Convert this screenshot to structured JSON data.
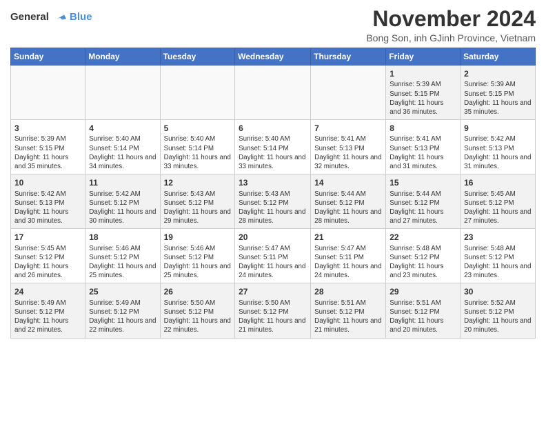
{
  "logo": {
    "line1": "General",
    "line2": "Blue"
  },
  "title": "November 2024",
  "subtitle": "Bong Son, inh GJinh Province, Vietnam",
  "weekdays": [
    "Sunday",
    "Monday",
    "Tuesday",
    "Wednesday",
    "Thursday",
    "Friday",
    "Saturday"
  ],
  "weeks": [
    [
      {
        "day": "",
        "info": ""
      },
      {
        "day": "",
        "info": ""
      },
      {
        "day": "",
        "info": ""
      },
      {
        "day": "",
        "info": ""
      },
      {
        "day": "",
        "info": ""
      },
      {
        "day": "1",
        "info": "Sunrise: 5:39 AM\nSunset: 5:15 PM\nDaylight: 11 hours and 36 minutes."
      },
      {
        "day": "2",
        "info": "Sunrise: 5:39 AM\nSunset: 5:15 PM\nDaylight: 11 hours and 35 minutes."
      }
    ],
    [
      {
        "day": "3",
        "info": "Sunrise: 5:39 AM\nSunset: 5:15 PM\nDaylight: 11 hours and 35 minutes."
      },
      {
        "day": "4",
        "info": "Sunrise: 5:40 AM\nSunset: 5:14 PM\nDaylight: 11 hours and 34 minutes."
      },
      {
        "day": "5",
        "info": "Sunrise: 5:40 AM\nSunset: 5:14 PM\nDaylight: 11 hours and 33 minutes."
      },
      {
        "day": "6",
        "info": "Sunrise: 5:40 AM\nSunset: 5:14 PM\nDaylight: 11 hours and 33 minutes."
      },
      {
        "day": "7",
        "info": "Sunrise: 5:41 AM\nSunset: 5:13 PM\nDaylight: 11 hours and 32 minutes."
      },
      {
        "day": "8",
        "info": "Sunrise: 5:41 AM\nSunset: 5:13 PM\nDaylight: 11 hours and 31 minutes."
      },
      {
        "day": "9",
        "info": "Sunrise: 5:42 AM\nSunset: 5:13 PM\nDaylight: 11 hours and 31 minutes."
      }
    ],
    [
      {
        "day": "10",
        "info": "Sunrise: 5:42 AM\nSunset: 5:13 PM\nDaylight: 11 hours and 30 minutes."
      },
      {
        "day": "11",
        "info": "Sunrise: 5:42 AM\nSunset: 5:12 PM\nDaylight: 11 hours and 30 minutes."
      },
      {
        "day": "12",
        "info": "Sunrise: 5:43 AM\nSunset: 5:12 PM\nDaylight: 11 hours and 29 minutes."
      },
      {
        "day": "13",
        "info": "Sunrise: 5:43 AM\nSunset: 5:12 PM\nDaylight: 11 hours and 28 minutes."
      },
      {
        "day": "14",
        "info": "Sunrise: 5:44 AM\nSunset: 5:12 PM\nDaylight: 11 hours and 28 minutes."
      },
      {
        "day": "15",
        "info": "Sunrise: 5:44 AM\nSunset: 5:12 PM\nDaylight: 11 hours and 27 minutes."
      },
      {
        "day": "16",
        "info": "Sunrise: 5:45 AM\nSunset: 5:12 PM\nDaylight: 11 hours and 27 minutes."
      }
    ],
    [
      {
        "day": "17",
        "info": "Sunrise: 5:45 AM\nSunset: 5:12 PM\nDaylight: 11 hours and 26 minutes."
      },
      {
        "day": "18",
        "info": "Sunrise: 5:46 AM\nSunset: 5:12 PM\nDaylight: 11 hours and 25 minutes."
      },
      {
        "day": "19",
        "info": "Sunrise: 5:46 AM\nSunset: 5:12 PM\nDaylight: 11 hours and 25 minutes."
      },
      {
        "day": "20",
        "info": "Sunrise: 5:47 AM\nSunset: 5:11 PM\nDaylight: 11 hours and 24 minutes."
      },
      {
        "day": "21",
        "info": "Sunrise: 5:47 AM\nSunset: 5:11 PM\nDaylight: 11 hours and 24 minutes."
      },
      {
        "day": "22",
        "info": "Sunrise: 5:48 AM\nSunset: 5:12 PM\nDaylight: 11 hours and 23 minutes."
      },
      {
        "day": "23",
        "info": "Sunrise: 5:48 AM\nSunset: 5:12 PM\nDaylight: 11 hours and 23 minutes."
      }
    ],
    [
      {
        "day": "24",
        "info": "Sunrise: 5:49 AM\nSunset: 5:12 PM\nDaylight: 11 hours and 22 minutes."
      },
      {
        "day": "25",
        "info": "Sunrise: 5:49 AM\nSunset: 5:12 PM\nDaylight: 11 hours and 22 minutes."
      },
      {
        "day": "26",
        "info": "Sunrise: 5:50 AM\nSunset: 5:12 PM\nDaylight: 11 hours and 22 minutes."
      },
      {
        "day": "27",
        "info": "Sunrise: 5:50 AM\nSunset: 5:12 PM\nDaylight: 11 hours and 21 minutes."
      },
      {
        "day": "28",
        "info": "Sunrise: 5:51 AM\nSunset: 5:12 PM\nDaylight: 11 hours and 21 minutes."
      },
      {
        "day": "29",
        "info": "Sunrise: 5:51 AM\nSunset: 5:12 PM\nDaylight: 11 hours and 20 minutes."
      },
      {
        "day": "30",
        "info": "Sunrise: 5:52 AM\nSunset: 5:12 PM\nDaylight: 11 hours and 20 minutes."
      }
    ]
  ]
}
